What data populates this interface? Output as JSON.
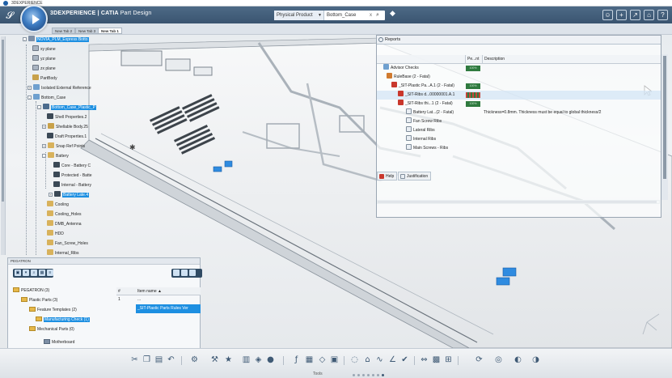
{
  "window": {
    "title": "3DEXPERIENCE"
  },
  "app": {
    "brand_bold": "3DEXPERIENCE | CATIA",
    "brand_app": "Part Design",
    "search_category": "Physical Product",
    "search_value": "Bottom_Case",
    "search_clear": "x"
  },
  "tabs": [
    {
      "label": "New Tab 2",
      "active": false
    },
    {
      "label": "New Tab 3",
      "active": false
    },
    {
      "label": "New Tab 1",
      "active": true
    }
  ],
  "tree": [
    {
      "label": "NOVIA_PLM_Express Botto",
      "icon": "product-icon",
      "selected": true
    },
    {
      "label": "xy plane",
      "icon": "plane-icon"
    },
    {
      "label": "yz plane",
      "icon": "plane-icon"
    },
    {
      "label": "zx plane",
      "icon": "plane-icon"
    },
    {
      "label": "PartBody",
      "icon": "body-icon"
    },
    {
      "label": "Isolated External Reference",
      "icon": "reference-icon"
    },
    {
      "label": "Bottom_Case",
      "icon": "part-icon"
    },
    {
      "label": "Bottom_Case_Plastic_P",
      "icon": "plastic-part-icon",
      "selected": true
    },
    {
      "label": "Shell Properties.2",
      "icon": "shell-icon"
    },
    {
      "label": "Shellable Body.25",
      "icon": "body-icon"
    },
    {
      "label": "Draft Properties.1",
      "icon": "draft-icon"
    },
    {
      "label": "Snap Ref Points",
      "icon": "points-icon"
    },
    {
      "label": "Battery",
      "icon": "geoset-icon"
    },
    {
      "label": "Core - Battery C",
      "icon": "feature-icon"
    },
    {
      "label": "Protected - Batte",
      "icon": "feature-icon"
    },
    {
      "label": "Internal - Battery",
      "icon": "feature-icon"
    },
    {
      "label": "Battery Late.4",
      "icon": "feature-icon",
      "selected": true
    },
    {
      "label": "Cooling",
      "icon": "geoset-icon"
    },
    {
      "label": "Cooling_Holes",
      "icon": "geoset-icon"
    },
    {
      "label": "DMB_Antenna",
      "icon": "geoset-icon"
    },
    {
      "label": "HDD",
      "icon": "geoset-icon"
    },
    {
      "label": "Fan_Screw_Holes",
      "icon": "geoset-icon"
    },
    {
      "label": "Internal_Ribs",
      "icon": "geoset-icon"
    },
    {
      "label": "Internal - Ribs",
      "icon": "feature-icon"
    }
  ],
  "pegatron": {
    "title": "PEGATRON",
    "root": "PEGATRON (3)",
    "items": [
      {
        "label": "Plastic Parts (3)"
      },
      {
        "label": "Feature Templates (2)"
      },
      {
        "label": "Manufacturing Check (1)",
        "selected": true
      },
      {
        "label": "Mechanical Parts (0)"
      },
      {
        "label": "Motherboard"
      }
    ],
    "table": {
      "headers": [
        "#",
        "Item name ▲"
      ],
      "rows": [
        {
          "num": "1",
          "name": "..."
        },
        {
          "num": "",
          "name": "_SIT-Plastic Parts Rules Ver",
          "selected": true
        }
      ]
    }
  },
  "reports": {
    "title": "Reports",
    "columns": [
      "",
      "Pe...nt",
      "Description"
    ],
    "rows": [
      {
        "name": "Advisor Checks",
        "icon": "checks-icon",
        "status": "100%",
        "desc": ""
      },
      {
        "name": "RuleBase (2 - Fatal)",
        "icon": "rulebase-icon",
        "status": "",
        "desc": ""
      },
      {
        "name": "_SIT-Plastic Pa...A.1 (2 - Fatal)",
        "icon": "fatal-icon",
        "status": "100%",
        "desc": ""
      },
      {
        "name": "_SIT-Ribs d...00000001.A.1",
        "icon": "fatal-icon",
        "status": "",
        "desc": ""
      },
      {
        "name": "_SIT-Ribs thi...1 (2 - Fatal)",
        "icon": "fatal-icon",
        "status": "100%",
        "desc": ""
      },
      {
        "name": "Battery Lat...(2 - Fatal)",
        "icon": "item-icon",
        "status": "",
        "desc": "Thickness=0.8mm. Thickness must be equal to global thickness/2"
      },
      {
        "name": "Fan Screw Ribs",
        "icon": "item-icon",
        "status": "",
        "desc": ""
      },
      {
        "name": "Lateral Ribs",
        "icon": "item-icon",
        "status": "",
        "desc": ""
      },
      {
        "name": "Internal Ribs",
        "icon": "item-icon",
        "status": "",
        "desc": ""
      },
      {
        "name": "Main Screws - Ribs",
        "icon": "item-icon",
        "status": "",
        "desc": ""
      }
    ],
    "bottom_tabs": [
      "Help",
      "Justification"
    ]
  },
  "actionbar": {
    "label": "Tools"
  },
  "colors": {
    "selection": "#1d8fe1",
    "topbar": "#3a5470",
    "fatal": "#c9372c",
    "ok": "#2f7a3f"
  }
}
